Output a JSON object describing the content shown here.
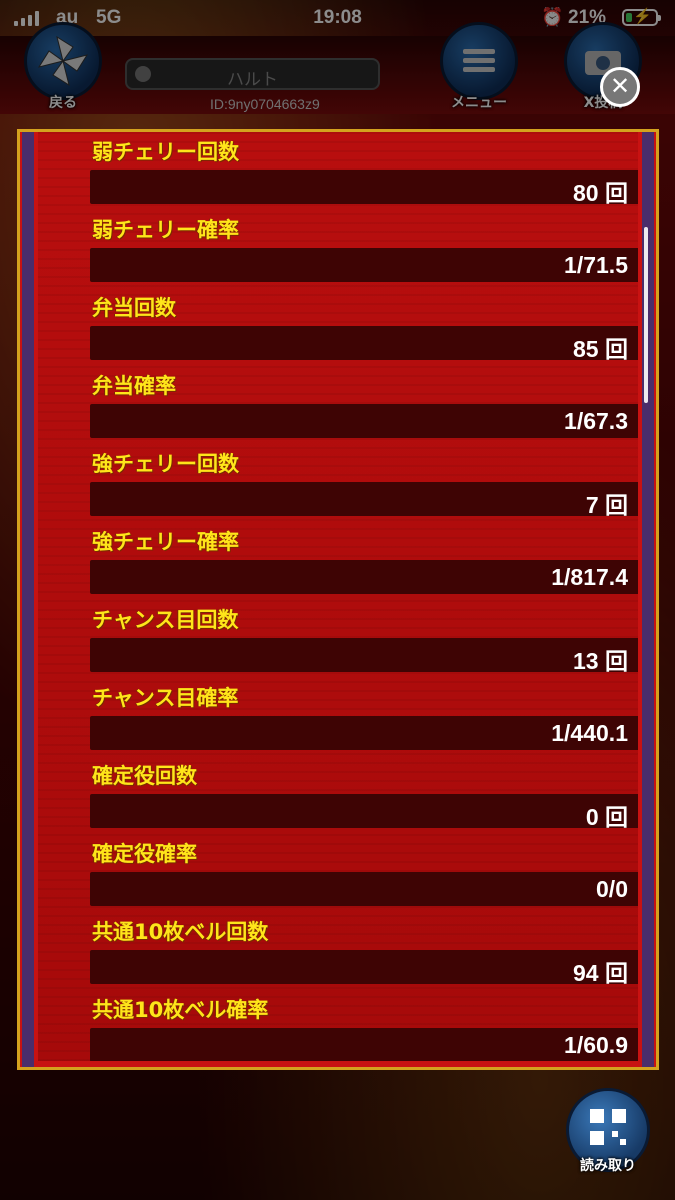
{
  "status_bar": {
    "carrier": "au",
    "network": "5G",
    "time": "19:08",
    "battery_percent": "21%",
    "battery_level": 0.21
  },
  "header": {
    "back_label": "戻る",
    "player_name": "ハルト",
    "player_id": "ID:9ny0704663z9",
    "menu_label": "メニュー",
    "camera_label": "X投稿",
    "close_glyph": "✕"
  },
  "stats": [
    {
      "label": "弱チェリー回数",
      "value": "80 回"
    },
    {
      "label": "弱チェリー確率",
      "value": "1/71.5"
    },
    {
      "label": "弁当回数",
      "value": "85 回"
    },
    {
      "label": "弁当確率",
      "value": "1/67.3"
    },
    {
      "label": "強チェリー回数",
      "value": "7 回"
    },
    {
      "label": "強チェリー確率",
      "value": "1/817.4"
    },
    {
      "label": "チャンス目回数",
      "value": "13 回"
    },
    {
      "label": "チャンス目確率",
      "value": "1/440.1"
    },
    {
      "label": "確定役回数",
      "value": "0 回"
    },
    {
      "label": "確定役確率",
      "value": "0/0"
    },
    {
      "label": "共通10枚ベル回数",
      "value": "94 回"
    },
    {
      "label": "共通10枚ベル確率",
      "value": "1/60.9"
    }
  ],
  "footer": {
    "scan_label": "読み取り"
  }
}
